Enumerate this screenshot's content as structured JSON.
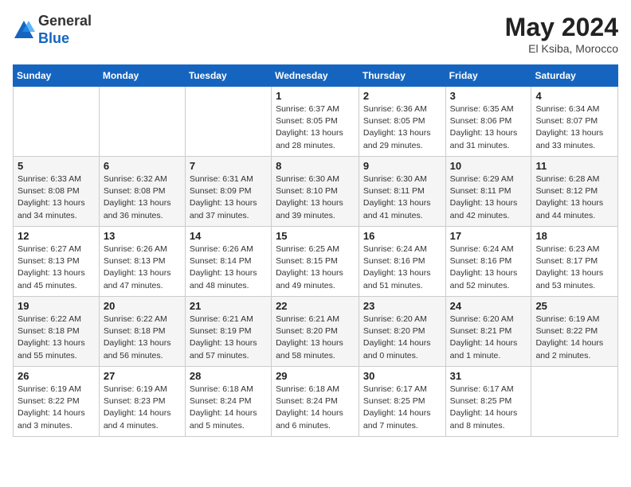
{
  "header": {
    "logo_general": "General",
    "logo_blue": "Blue",
    "month_year": "May 2024",
    "location": "El Ksiba, Morocco"
  },
  "weekdays": [
    "Sunday",
    "Monday",
    "Tuesday",
    "Wednesday",
    "Thursday",
    "Friday",
    "Saturday"
  ],
  "weeks": [
    [
      {
        "day": "",
        "info": ""
      },
      {
        "day": "",
        "info": ""
      },
      {
        "day": "",
        "info": ""
      },
      {
        "day": "1",
        "info": "Sunrise: 6:37 AM\nSunset: 8:05 PM\nDaylight: 13 hours\nand 28 minutes."
      },
      {
        "day": "2",
        "info": "Sunrise: 6:36 AM\nSunset: 8:05 PM\nDaylight: 13 hours\nand 29 minutes."
      },
      {
        "day": "3",
        "info": "Sunrise: 6:35 AM\nSunset: 8:06 PM\nDaylight: 13 hours\nand 31 minutes."
      },
      {
        "day": "4",
        "info": "Sunrise: 6:34 AM\nSunset: 8:07 PM\nDaylight: 13 hours\nand 33 minutes."
      }
    ],
    [
      {
        "day": "5",
        "info": "Sunrise: 6:33 AM\nSunset: 8:08 PM\nDaylight: 13 hours\nand 34 minutes."
      },
      {
        "day": "6",
        "info": "Sunrise: 6:32 AM\nSunset: 8:08 PM\nDaylight: 13 hours\nand 36 minutes."
      },
      {
        "day": "7",
        "info": "Sunrise: 6:31 AM\nSunset: 8:09 PM\nDaylight: 13 hours\nand 37 minutes."
      },
      {
        "day": "8",
        "info": "Sunrise: 6:30 AM\nSunset: 8:10 PM\nDaylight: 13 hours\nand 39 minutes."
      },
      {
        "day": "9",
        "info": "Sunrise: 6:30 AM\nSunset: 8:11 PM\nDaylight: 13 hours\nand 41 minutes."
      },
      {
        "day": "10",
        "info": "Sunrise: 6:29 AM\nSunset: 8:11 PM\nDaylight: 13 hours\nand 42 minutes."
      },
      {
        "day": "11",
        "info": "Sunrise: 6:28 AM\nSunset: 8:12 PM\nDaylight: 13 hours\nand 44 minutes."
      }
    ],
    [
      {
        "day": "12",
        "info": "Sunrise: 6:27 AM\nSunset: 8:13 PM\nDaylight: 13 hours\nand 45 minutes."
      },
      {
        "day": "13",
        "info": "Sunrise: 6:26 AM\nSunset: 8:13 PM\nDaylight: 13 hours\nand 47 minutes."
      },
      {
        "day": "14",
        "info": "Sunrise: 6:26 AM\nSunset: 8:14 PM\nDaylight: 13 hours\nand 48 minutes."
      },
      {
        "day": "15",
        "info": "Sunrise: 6:25 AM\nSunset: 8:15 PM\nDaylight: 13 hours\nand 49 minutes."
      },
      {
        "day": "16",
        "info": "Sunrise: 6:24 AM\nSunset: 8:16 PM\nDaylight: 13 hours\nand 51 minutes."
      },
      {
        "day": "17",
        "info": "Sunrise: 6:24 AM\nSunset: 8:16 PM\nDaylight: 13 hours\nand 52 minutes."
      },
      {
        "day": "18",
        "info": "Sunrise: 6:23 AM\nSunset: 8:17 PM\nDaylight: 13 hours\nand 53 minutes."
      }
    ],
    [
      {
        "day": "19",
        "info": "Sunrise: 6:22 AM\nSunset: 8:18 PM\nDaylight: 13 hours\nand 55 minutes."
      },
      {
        "day": "20",
        "info": "Sunrise: 6:22 AM\nSunset: 8:18 PM\nDaylight: 13 hours\nand 56 minutes."
      },
      {
        "day": "21",
        "info": "Sunrise: 6:21 AM\nSunset: 8:19 PM\nDaylight: 13 hours\nand 57 minutes."
      },
      {
        "day": "22",
        "info": "Sunrise: 6:21 AM\nSunset: 8:20 PM\nDaylight: 13 hours\nand 58 minutes."
      },
      {
        "day": "23",
        "info": "Sunrise: 6:20 AM\nSunset: 8:20 PM\nDaylight: 14 hours\nand 0 minutes."
      },
      {
        "day": "24",
        "info": "Sunrise: 6:20 AM\nSunset: 8:21 PM\nDaylight: 14 hours\nand 1 minute."
      },
      {
        "day": "25",
        "info": "Sunrise: 6:19 AM\nSunset: 8:22 PM\nDaylight: 14 hours\nand 2 minutes."
      }
    ],
    [
      {
        "day": "26",
        "info": "Sunrise: 6:19 AM\nSunset: 8:22 PM\nDaylight: 14 hours\nand 3 minutes."
      },
      {
        "day": "27",
        "info": "Sunrise: 6:19 AM\nSunset: 8:23 PM\nDaylight: 14 hours\nand 4 minutes."
      },
      {
        "day": "28",
        "info": "Sunrise: 6:18 AM\nSunset: 8:24 PM\nDaylight: 14 hours\nand 5 minutes."
      },
      {
        "day": "29",
        "info": "Sunrise: 6:18 AM\nSunset: 8:24 PM\nDaylight: 14 hours\nand 6 minutes."
      },
      {
        "day": "30",
        "info": "Sunrise: 6:17 AM\nSunset: 8:25 PM\nDaylight: 14 hours\nand 7 minutes."
      },
      {
        "day": "31",
        "info": "Sunrise: 6:17 AM\nSunset: 8:25 PM\nDaylight: 14 hours\nand 8 minutes."
      },
      {
        "day": "",
        "info": ""
      }
    ]
  ]
}
